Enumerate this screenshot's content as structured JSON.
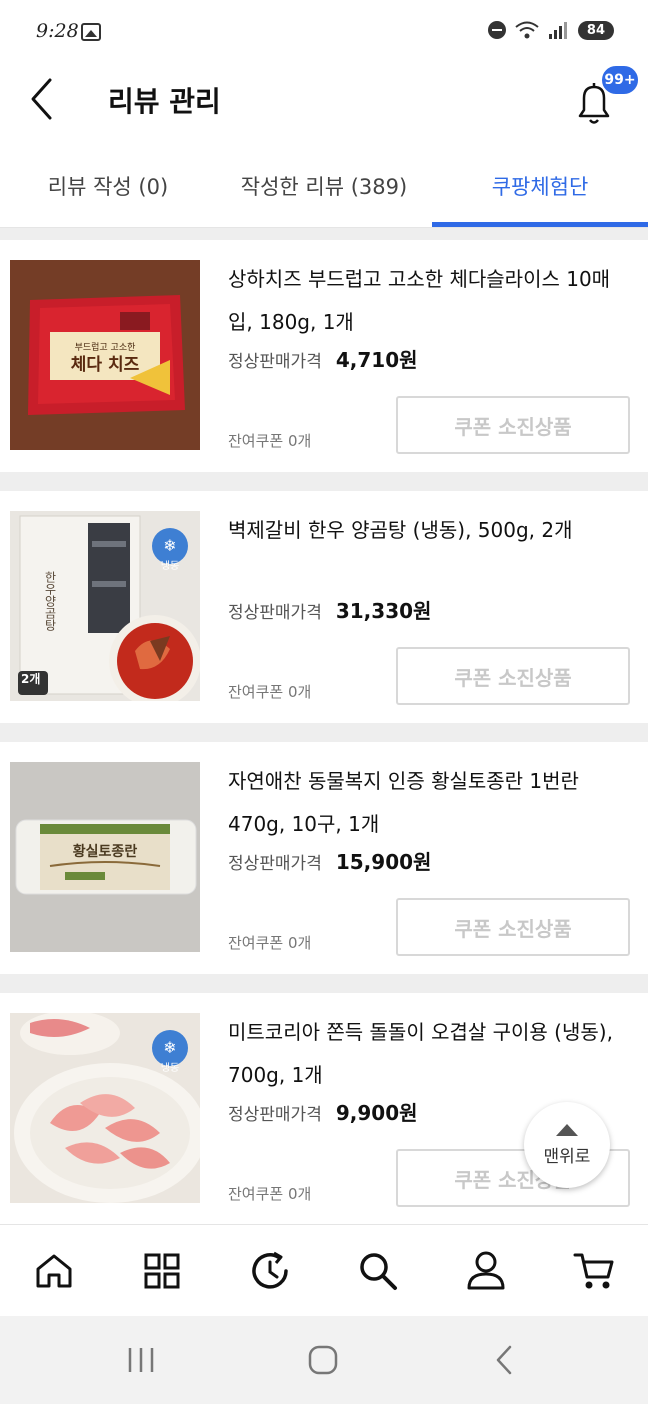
{
  "status_bar": {
    "time": "9:28",
    "battery": "84"
  },
  "header": {
    "title": "리뷰 관리",
    "notification_badge": "99+"
  },
  "tabs": [
    {
      "label": "리뷰 작성 (0)"
    },
    {
      "label": "작성한 리뷰 (389)"
    },
    {
      "label": "쿠팡체험단",
      "active": true
    }
  ],
  "colors": {
    "accent": "#2f6ae6",
    "disabled": "#c8c8c8"
  },
  "items": [
    {
      "name": "상하치즈 부드럽고 고소한 체다슬라이스 10매입, 180g, 1개",
      "price_label": "정상판매가격",
      "price": "4,710원",
      "coupon_left": "잔여쿠폰 0개",
      "button": "쿠폰 소진상품",
      "image": "cheese-slice-package"
    },
    {
      "name": "벽제갈비 한우 양곰탕 (냉동), 500g, 2개",
      "price_label": "정상판매가격",
      "price": "31,330원",
      "coupon_left": "잔여쿠폰 0개",
      "button": "쿠폰 소진상품",
      "image": "beef-soup-package",
      "badge": "냉동",
      "count_badge": "2개"
    },
    {
      "name": "자연애찬 동물복지 인증 황실토종란 1번란 470g, 10구, 1개",
      "price_label": "정상판매가격",
      "price": "15,900원",
      "coupon_left": "잔여쿠폰 0개",
      "button": "쿠폰 소진상품",
      "image": "egg-carton"
    },
    {
      "name": "미트코리아 쫀득 돌돌이 오겹살 구이용 (냉동), 700g, 1개",
      "price_label": "정상판매가격",
      "price": "9,900원",
      "coupon_left": "잔여쿠폰 0개",
      "button": "쿠폰 소진상품",
      "image": "pork-belly-plate",
      "badge": "냉동"
    }
  ],
  "scroll_top_label": "맨위로",
  "bottom_nav": [
    {
      "icon": "home-icon"
    },
    {
      "icon": "category-grid-icon"
    },
    {
      "icon": "recent-history-icon"
    },
    {
      "icon": "search-icon"
    },
    {
      "icon": "profile-icon"
    },
    {
      "icon": "cart-icon"
    }
  ],
  "system_nav": [
    {
      "icon": "recent-apps-icon"
    },
    {
      "icon": "home-circle-icon"
    },
    {
      "icon": "back-icon"
    }
  ]
}
